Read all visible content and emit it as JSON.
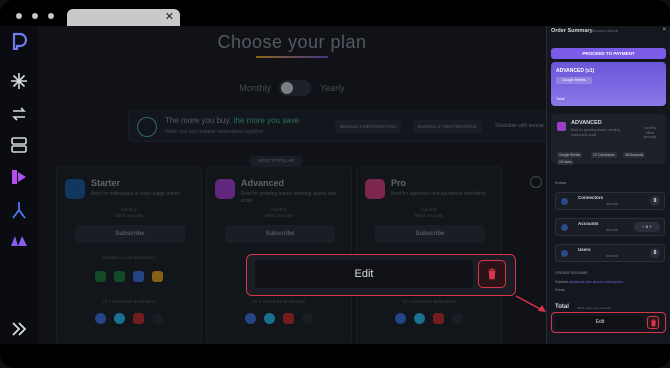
{
  "window": {
    "tab_close": "✕"
  },
  "main": {
    "title": "Choose your plan",
    "billing": {
      "monthly": "Monthly",
      "yearly": "Yearly"
    },
    "promo": {
      "headline_prefix": "The more you buy,",
      "headline_highlight": "the more you save",
      "subline": "When you buy multiple destinations together",
      "chips": [
        "BUNDLE 2 DESTINATIONS",
        "BUNDLE 3+ DESTINATIONS"
      ],
      "stackable": "Stackable with annual"
    },
    "most_popular": "MOST POPULAR",
    "plans": [
      {
        "name": "Starter",
        "desc": "Best for individuals or early-stage teams",
        "billing": "monthly\nbilled annually",
        "button": "Subscribe",
        "included": "Includes 1 core destination",
        "enterprise": "Or 1 enterprise destination",
        "color": "#1e5a9a"
      },
      {
        "name": "Advanced",
        "desc": "Best for growing teams needing speed and scale",
        "billing": "monthly\nbilled annually",
        "button": "Subscribe",
        "included": "",
        "enterprise": "Or 1 enterprise destination",
        "color": "#9c3fc8"
      },
      {
        "name": "Pro",
        "desc": "Best for agencies and advanced marketing",
        "billing": "monthly\nbilled annually",
        "button": "Subscribe",
        "included": "",
        "enterprise": "Or 1 enterprise destination",
        "color": "#c83f7a"
      }
    ],
    "edit_overlay": {
      "label": "Edit"
    }
  },
  "panel": {
    "title": "Order Summary",
    "subtitle": "Advanced annual",
    "proceed": "PROCEED TO PAYMENT",
    "plan_card": {
      "title": "ADVANCED (x1)",
      "destination": "Google Sheets",
      "total": "Total"
    },
    "summary": {
      "plan": "ADVANCED",
      "desc": "Best for growing teams needing speed and scale",
      "billing": "monthly\nbilled\nannually",
      "tags": [
        "Google Sheets",
        "1/7 Connectors",
        "3/5 Accounts",
        "15 Users"
      ]
    },
    "extras_label": "Extras",
    "extras": [
      {
        "name": "Connectors",
        "each": "/ea each",
        "value": "0"
      },
      {
        "name": "Accounts",
        "each": "/ea each",
        "value": "0"
      },
      {
        "name": "Users",
        "each": "/ea each",
        "value": "0"
      }
    ],
    "resume": {
      "label": "ORDER RESUME",
      "subtotal_prefix": "Subtotal",
      "subtotal_highlight": "advanced plan annual subscription",
      "extras": "Extras"
    },
    "total": {
      "label": "Total",
      "sub": "billed yearly, tax excluded"
    },
    "edit": {
      "label": "Edit"
    }
  },
  "colors": {
    "accent": "#7b5ce8",
    "danger": "#d8344a",
    "green": "#47b58a"
  }
}
